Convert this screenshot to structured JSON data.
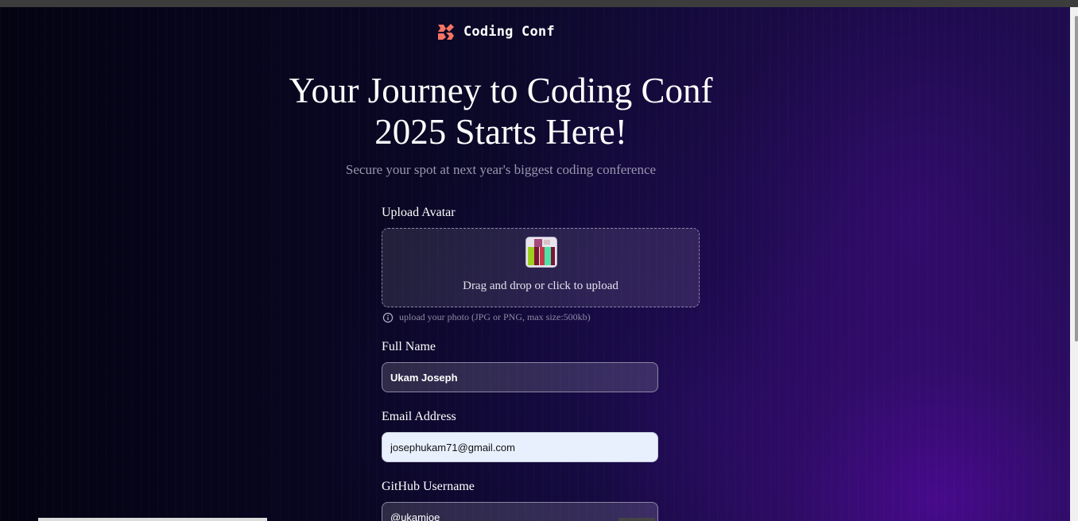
{
  "brand": {
    "name": "Coding Conf",
    "accent": "#f57463"
  },
  "hero": {
    "title": "Your Journey to Coding Conf 2025 Starts Here!",
    "subtitle": "Secure your spot at next year's biggest coding conference"
  },
  "form": {
    "avatar": {
      "label": "Upload Avatar",
      "dropzone_text": "Drag and drop or click to upload",
      "hint": "upload your photo (JPG or PNG, max size:500kb)"
    },
    "full_name": {
      "label": "Full Name",
      "value": "Ukam Joseph"
    },
    "email": {
      "label": "Email Address",
      "value": "josephukam71@gmail.com"
    },
    "github": {
      "label": "GitHub Username",
      "value": "@ukamjoe"
    }
  },
  "icons": {
    "logo": "coding-conf-logo-icon",
    "hint": "info-icon"
  }
}
